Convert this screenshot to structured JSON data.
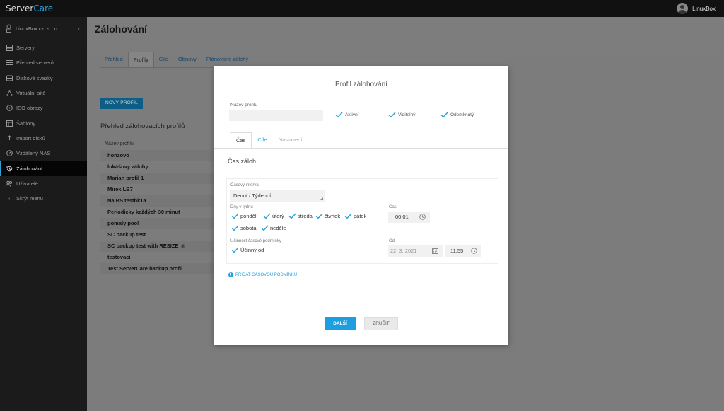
{
  "app": {
    "logo_part1": "Server",
    "logo_part2": "Care",
    "user_name": "LinuxBox"
  },
  "sidebar": {
    "company": "LinuxBox.cz, s.r.o",
    "items": [
      {
        "label": "Servery",
        "icon": "server-icon"
      },
      {
        "label": "Přehled serverů",
        "icon": "list-icon"
      },
      {
        "label": "Diskové svazky",
        "icon": "disk-icon"
      },
      {
        "label": "Virtuální sítě",
        "icon": "network-icon"
      },
      {
        "label": "ISO obrazy",
        "icon": "disc-icon"
      },
      {
        "label": "Šablony",
        "icon": "template-icon"
      },
      {
        "label": "Import disků",
        "icon": "upload-icon"
      },
      {
        "label": "Vzdálený NAS",
        "icon": "nas-icon"
      },
      {
        "label": "Zálohování",
        "icon": "backup-icon"
      },
      {
        "label": "Uživatelé",
        "icon": "users-icon"
      },
      {
        "label": "Skrýt menu",
        "icon": "chevron-left-icon"
      }
    ]
  },
  "page": {
    "title": "Zálohování",
    "tabs": [
      "Přehled",
      "Profily",
      "Cíle",
      "Obnovy",
      "Plánované zálohy"
    ],
    "new_profile_button": "NOVÝ PROFIL",
    "profiles_title": "Přehled zálohovacích profilů",
    "column_header": "Název profilu",
    "profiles": [
      "honzovo",
      "lukášovy zálohy",
      "Marian profil 1",
      "Mirek LB7",
      "Na BS testbk1a",
      "Periodicky každých 30 minut",
      "pomaly pool",
      "SC backup test",
      "SC backup test with RESIZE",
      "testovaci",
      "Test ServerCare backup profil"
    ]
  },
  "modal": {
    "title": "Profil zálohování",
    "name_label": "Název profilu",
    "name_value": "",
    "checks": {
      "active": "Aktivní",
      "visible": "Viditelný",
      "unlocked": "Odemknutý"
    },
    "tabs": [
      "Čas",
      "Cíle",
      "Nastavení"
    ],
    "section_title": "Čas záloh",
    "interval_label": "Časový interval",
    "interval_value": "Denní / Týdenní",
    "days_label": "Dny v týdnu",
    "days": [
      "pondělí",
      "úterý",
      "středa",
      "čtvrtek",
      "pátek",
      "sobota",
      "neděle"
    ],
    "time_label": "Čas",
    "time_value": "00:01",
    "validity_label": "Účinnost časové podmínky",
    "effective_from": "Účinný od",
    "from_label": "Od",
    "from_date": "22. 3. 2021",
    "from_time": "11:55",
    "add_condition": "PŘIDAT ČASOVOU PODMÍNKU",
    "next_button": "DALŠÍ",
    "cancel_button": "ZRUŠIT"
  },
  "colors": {
    "accent": "#2a9fd8",
    "topbar": "#111111",
    "sidebar": "#1b1b1b",
    "overlay": "#7e7e7e",
    "primary_button": "#1c9ee0"
  }
}
